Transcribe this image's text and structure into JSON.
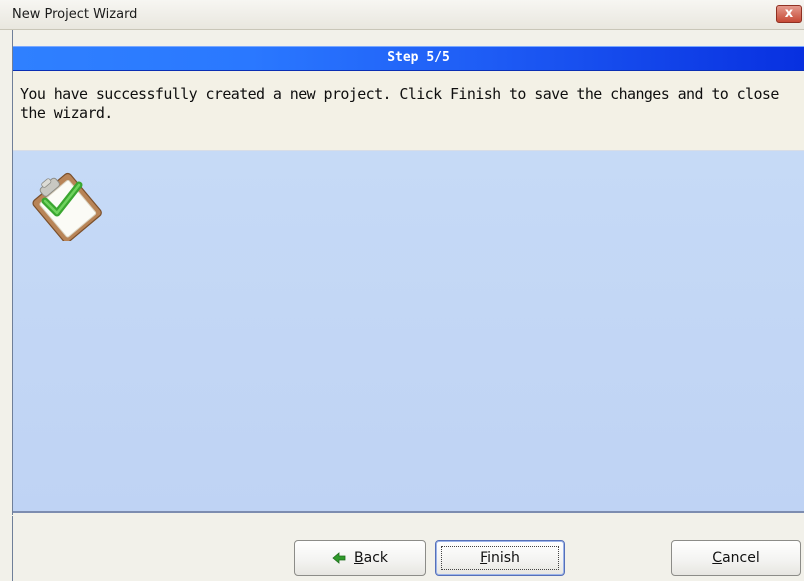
{
  "window": {
    "title": "New Project Wizard",
    "close_label": "x"
  },
  "step": {
    "label": "Step 5/5"
  },
  "message": {
    "text": "You have successfully created a new project. Click Finish to save the changes and to close the wizard."
  },
  "icons": {
    "clipboard": "clipboard-checkmark-icon",
    "back": "green-back-arrow-icon"
  },
  "buttons": {
    "back": {
      "accel": "B",
      "rest": "ack"
    },
    "finish": {
      "accel": "F",
      "rest": "inish"
    },
    "cancel": {
      "accel": "C",
      "rest": "ancel"
    }
  },
  "colors": {
    "step_bar_start": "#2f80ff",
    "step_bar_end": "#0830e0",
    "content_bg": "#c6daf6",
    "close_button": "#c64a36",
    "check_green": "#3aa630"
  }
}
